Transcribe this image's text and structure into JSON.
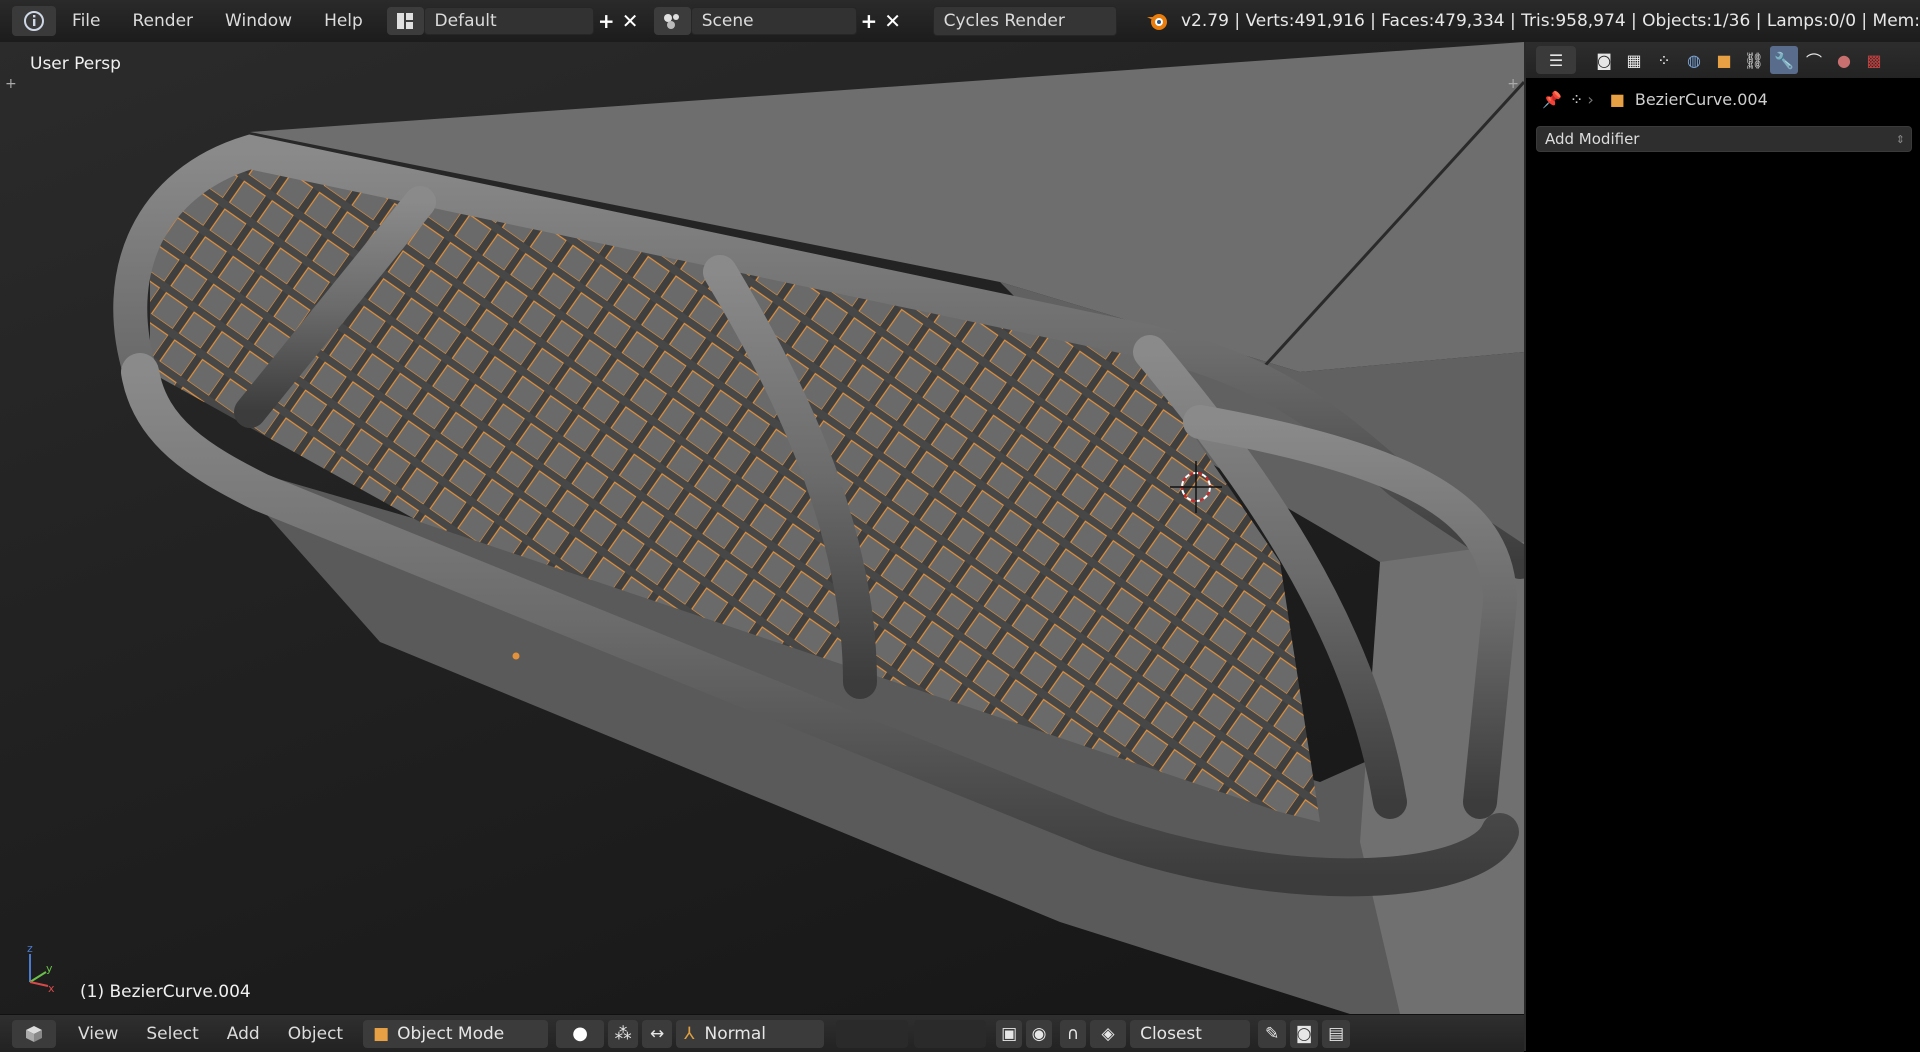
{
  "menu": [
    "File",
    "Render",
    "Window",
    "Help"
  ],
  "layout": {
    "name": "Default"
  },
  "scene": {
    "name": "Scene"
  },
  "engine": {
    "name": "Cycles Render"
  },
  "stats": "v2.79 | Verts:491,916 | Faces:479,334 | Tris:958,974 | Objects:1/36 | Lamps:0/0 | Mem:",
  "viewport": {
    "view_label": "User Persp",
    "object_label": "(1) BezierCurve.004"
  },
  "bottom_menu": [
    "View",
    "Select",
    "Add",
    "Object"
  ],
  "mode": "Object Mode",
  "orientation": "Normal",
  "snap_target": "Closest",
  "properties": {
    "object_name": "BezierCurve.004",
    "add_modifier_label": "Add Modifier",
    "active_tab": "wrench-icon"
  },
  "colors": {
    "wire_orange": "#e3913b",
    "mesh_gray": "#6d6d6d",
    "active_tab": "#5a6c8c"
  }
}
